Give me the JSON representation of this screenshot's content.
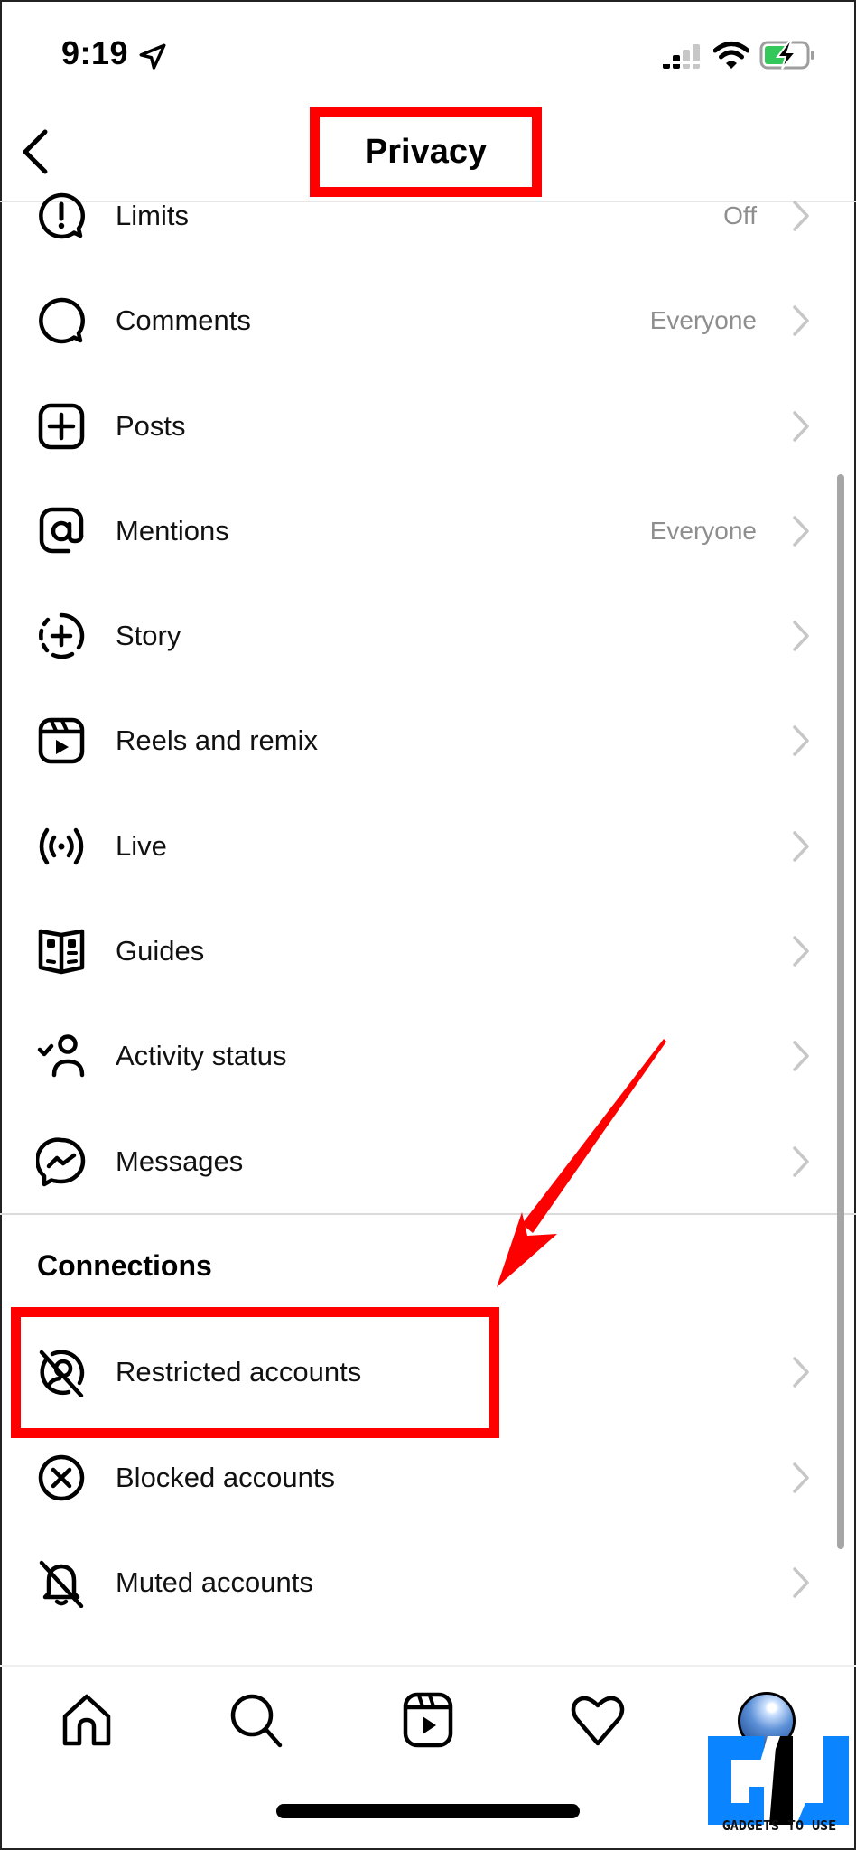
{
  "status_bar": {
    "time": "9:19",
    "icons": [
      "location-arrow-icon",
      "cellular-signal-icon",
      "wifi-icon",
      "battery-charging-icon"
    ],
    "battery_color": "#34c759"
  },
  "nav": {
    "back_icon": "chevron-left-icon",
    "title": "Privacy"
  },
  "rows": [
    {
      "label": "Limits",
      "value": "Off",
      "icon": "limits-alert-bubble-icon"
    },
    {
      "label": "Comments",
      "value": "Everyone",
      "icon": "comment-bubble-icon"
    },
    {
      "label": "Posts",
      "value": "",
      "icon": "plus-square-icon"
    },
    {
      "label": "Mentions",
      "value": "Everyone",
      "icon": "at-sign-icon"
    },
    {
      "label": "Story",
      "value": "",
      "icon": "story-dashed-plus-icon"
    },
    {
      "label": "Reels and remix",
      "value": "",
      "icon": "reels-icon"
    },
    {
      "label": "Live",
      "value": "",
      "icon": "live-broadcast-icon"
    },
    {
      "label": "Guides",
      "value": "",
      "icon": "guides-book-icon"
    },
    {
      "label": "Activity status",
      "value": "",
      "icon": "activity-status-person-icon"
    },
    {
      "label": "Messages",
      "value": "",
      "icon": "messenger-icon"
    }
  ],
  "connections": {
    "title": "Connections",
    "rows": [
      {
        "label": "Restricted accounts",
        "icon": "restricted-icon"
      },
      {
        "label": "Blocked accounts",
        "icon": "blocked-x-circle-icon"
      },
      {
        "label": "Muted accounts",
        "icon": "muted-bell-icon"
      }
    ]
  },
  "tab_bar": {
    "tabs": [
      "home-icon",
      "search-icon",
      "reels-tab-icon",
      "activity-heart-icon",
      "profile-avatar"
    ]
  },
  "annotations": {
    "highlight_color": "#ff0000",
    "highlighted": [
      "Privacy",
      "Restricted accounts"
    ]
  },
  "watermark": {
    "text": "GADGETS TO USE",
    "logo_color": "#0a84ff"
  }
}
